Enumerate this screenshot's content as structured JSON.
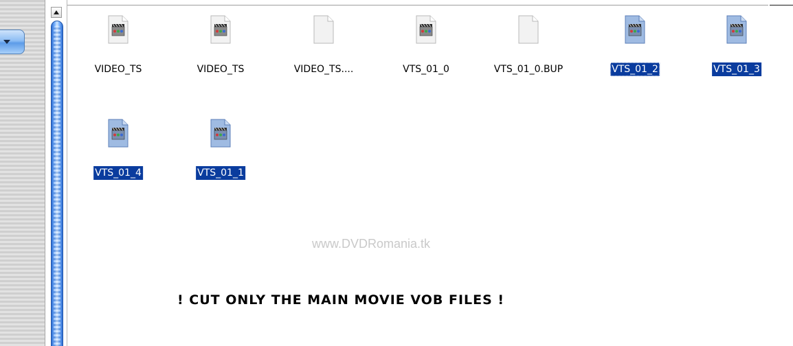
{
  "files": [
    {
      "label": "VIDEO_TS",
      "icon": "video-file-icon",
      "selected": false
    },
    {
      "label": "VIDEO_TS",
      "icon": "video-file-icon",
      "selected": false
    },
    {
      "label": "VIDEO_TS....",
      "icon": "blank-file-icon",
      "selected": false
    },
    {
      "label": "VTS_01_0",
      "icon": "video-file-icon",
      "selected": false
    },
    {
      "label": "VTS_01_0.BUP",
      "icon": "blank-file-icon",
      "selected": false
    },
    {
      "label": "VTS_01_2",
      "icon": "video-file-icon",
      "selected": true
    },
    {
      "label": "VTS_01_3",
      "icon": "video-file-icon",
      "selected": true
    },
    {
      "label": "VTS_01_4",
      "icon": "video-file-icon",
      "selected": true
    },
    {
      "label": "VTS_01_1",
      "icon": "video-file-icon",
      "selected": true
    }
  ],
  "watermark": "www.DVDRomania.tk",
  "caption": "! CUT ONLY THE MAIN MOVIE VOB FILES !",
  "colors": {
    "selection": "#0a3c9e",
    "scroll_thumb": "#2d6fd3"
  }
}
